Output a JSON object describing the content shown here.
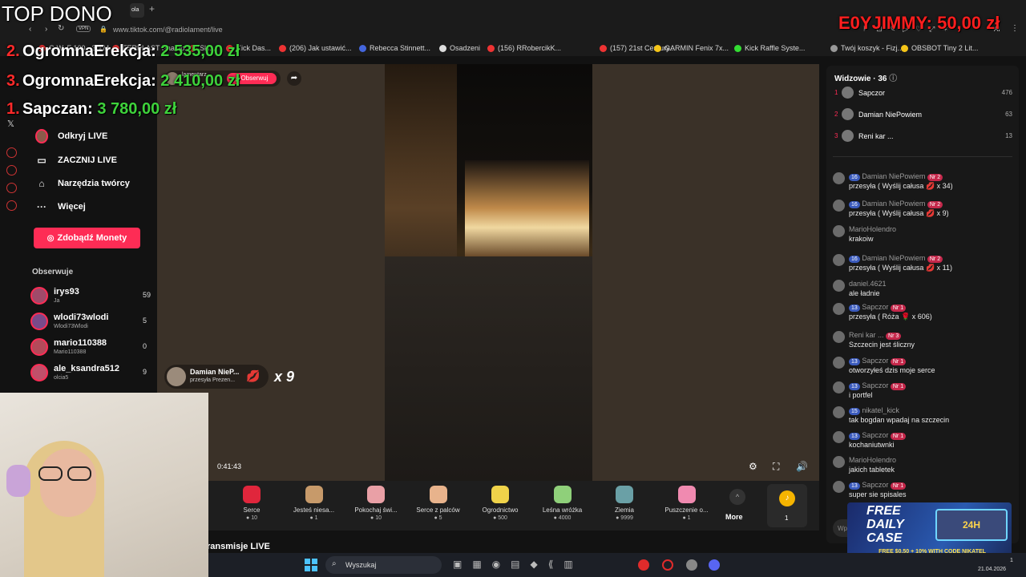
{
  "browser": {
    "url": "www.tiktok.com/@radiolament/live",
    "vpn": "VPN",
    "tab_fragment": "ola",
    "new_tab": "+",
    "bookmarks": [
      "G.W. F 100 - 3D M...",
      "FERPLAST Paamo...",
      "Skl...",
      "Kick Das...",
      "(206) Jak ustawić...",
      "Rebecca Stinnett...",
      "Osadzeni",
      "(156) RRobercikK...",
      "(157) 21st Century...",
      "GARMIN Fenix 7x...",
      "Kick Raffle Syste...",
      "Twój koszyk - Fizj...",
      "OBSBOT Tiny 2 Lit..."
    ]
  },
  "overlay": {
    "top_title": "TOP DONO",
    "top_donors": [
      {
        "rank": "2.",
        "name": "OgromnaErekcja:",
        "amount": "2 535,00 zł"
      },
      {
        "rank": "3.",
        "name": "OgromnaErekcja:",
        "amount": "2 410,00 zł"
      },
      {
        "rank": "1.",
        "name": "Sapczan:",
        "amount": "3 780,00 zł"
      }
    ],
    "latest_label": "E0YJIMMY:",
    "latest_amount": "50,00 zł"
  },
  "sidebar": {
    "nav": [
      {
        "label": "Odkryj LIVE",
        "icon": "avatar-icon"
      },
      {
        "label": "ZACZNIJ LIVE",
        "icon": "camera-icon"
      },
      {
        "label": "Narzędzia twórcy",
        "icon": "home-icon"
      },
      {
        "label": "Więcej",
        "icon": "more-icon"
      }
    ],
    "coins_button": "Zdobądź Monety",
    "following_title": "Obserwuje",
    "following": [
      {
        "name": "irys93",
        "sub": "Ja",
        "count": "59",
        "color": "#a04a6a"
      },
      {
        "name": "wlodi73wlodi",
        "sub": "Wlodi73Wlodi",
        "count": "5",
        "color": "#7a4a8a"
      },
      {
        "name": "mario110388",
        "sub": "Mario110388",
        "count": "0",
        "color": "#b44a5a"
      },
      {
        "name": "ale_ksandra512",
        "sub": "olcia5",
        "count": "9",
        "color": "#c0506a"
      }
    ]
  },
  "stream": {
    "host_name": "lamentarz",
    "follow_label": "+ Obserwuj",
    "elapsed": "0:41:43",
    "gift_popup": {
      "user": "Damian NieP...",
      "text": "przesyła Prezen...",
      "count": "x 9"
    },
    "footer_text": "ransmisje LIVE"
  },
  "gifts": [
    {
      "name": "Serce",
      "price": "10",
      "color": "#e0263c"
    },
    {
      "name": "Jesteś niesa...",
      "price": "1",
      "color": "#c79a6a"
    },
    {
      "name": "Pokochaj świ...",
      "price": "10",
      "color": "#e9a0a6"
    },
    {
      "name": "Serce z palców",
      "price": "5",
      "color": "#e8b38c"
    },
    {
      "name": "Ogrodnictwo",
      "price": "500",
      "color": "#f0d34a"
    },
    {
      "name": "Leśna wróżka",
      "price": "4000",
      "color": "#8fd07a"
    },
    {
      "name": "Ziemia",
      "price": "9999",
      "color": "#6aa0a6"
    },
    {
      "name": "Puszczenie o...",
      "price": "1",
      "color": "#f08ab0"
    }
  ],
  "gift_more": "More",
  "gift_coin_count": "1",
  "chat": {
    "viewers_label": "Widzowie",
    "viewers_count": "36",
    "top_viewers": [
      {
        "rank": "1",
        "name": "Sapczor",
        "score": "476"
      },
      {
        "rank": "2",
        "name": "Damian NiePowiem",
        "score": "63"
      },
      {
        "rank": "3",
        "name": "Reni kar ... ",
        "score": "13"
      }
    ],
    "messages": [
      {
        "lvl": "16",
        "user": "Damian NiePowiem",
        "nr": "Nr 2",
        "text": "przesyła ( Wyślij całusa 💋 x 34)"
      },
      {
        "lvl": "16",
        "user": "Damian NiePowiem",
        "nr": "Nr 2",
        "text": "przesyła ( Wyślij całusa 💋 x 9)"
      },
      {
        "lvl": "",
        "user": "MarioHolendro",
        "nr": "",
        "text": "krakoiw"
      },
      {
        "lvl": "16",
        "user": "Damian NiePowiem",
        "nr": "Nr 2",
        "text": "przesyła ( Wyślij całusa 💋 x 11)"
      },
      {
        "lvl": "",
        "user": "daniel.4621",
        "nr": "",
        "text": "ale ładnie"
      },
      {
        "lvl": "13",
        "user": "Sapczor",
        "nr": "Nr 1",
        "text": "przesyła ( Róża 🌹 x 606)"
      },
      {
        "lvl": "",
        "user": "Reni kar ...",
        "nr": "Nr 3",
        "text": "Szczecin jest śliczny"
      },
      {
        "lvl": "13",
        "user": "Sapczor",
        "nr": "Nr 1",
        "text": "otworzyłeś dzis moje serce"
      },
      {
        "lvl": "13",
        "user": "Sapczor",
        "nr": "Nr 1",
        "text": "i portfel"
      },
      {
        "lvl": "15",
        "user": "nikatel_kick",
        "nr": "",
        "text": "tak bogdan wpadaj na szczecin"
      },
      {
        "lvl": "13",
        "user": "Sapczor",
        "nr": "Nr 1",
        "text": "kochaniutwnki"
      },
      {
        "lvl": "",
        "user": "MarioHolendro",
        "nr": "",
        "text": "jakich tabletek"
      },
      {
        "lvl": "13",
        "user": "Sapczor",
        "nr": "Nr 1",
        "text": "super sie spisales"
      }
    ],
    "input_placeholder": "Wp"
  },
  "promo": {
    "title1": "FREE",
    "title2": "DAILY",
    "title3": "CASE",
    "box_label": "24H",
    "footer": "FREE $0.50 + 10% WITH CODE NIKATEL"
  },
  "taskbar": {
    "search": "Wyszukaj",
    "date": "21.04.2026",
    "tray_time": "1"
  },
  "colors": {
    "accent": "#fe2c55",
    "coins": "#3ed23b",
    "tiktok_bg": "#121212"
  }
}
